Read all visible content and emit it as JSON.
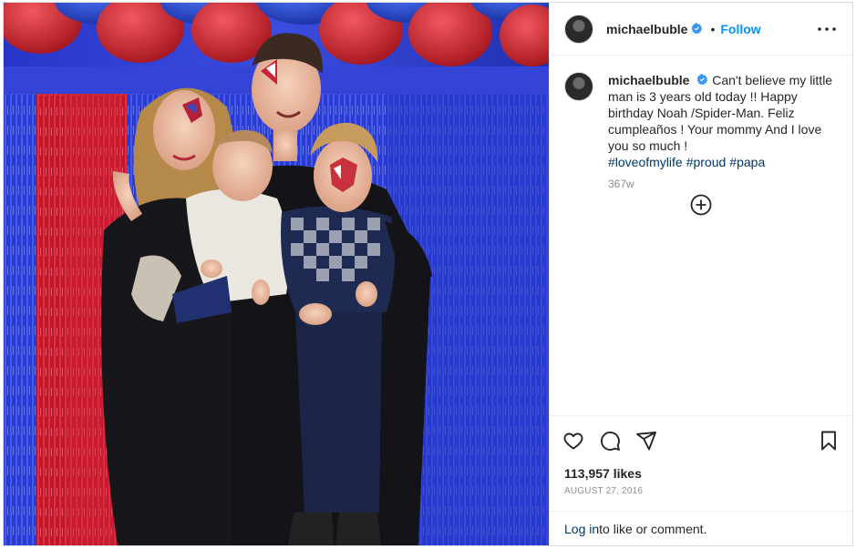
{
  "photo": {
    "alt": "Family birthday photo"
  },
  "header": {
    "username": "michaelbuble",
    "separator": "•",
    "follow_label": "Follow",
    "more_label": "More options"
  },
  "caption": {
    "username": "michaelbuble",
    "text": "Can't believe my little man is 3 years old today !! Happy birthday Noah /Spider-Man. Feliz cumpleaños ! Your mommy And I love you so much !",
    "hashtags": [
      "#loveofmylife",
      "#proud",
      "#papa"
    ],
    "time_ago": "367w"
  },
  "actions": {
    "like_icon": "heart-icon",
    "comment_icon": "comment-icon",
    "share_icon": "share-icon",
    "save_icon": "bookmark-icon"
  },
  "stats": {
    "likes": "113,957 likes",
    "date": "AUGUST 27, 2016"
  },
  "login": {
    "link": "Log in",
    "rest": " to like or comment."
  },
  "colors": {
    "accent": "#0095f6",
    "hashtag": "#00376b",
    "verified": "#3897f0"
  }
}
